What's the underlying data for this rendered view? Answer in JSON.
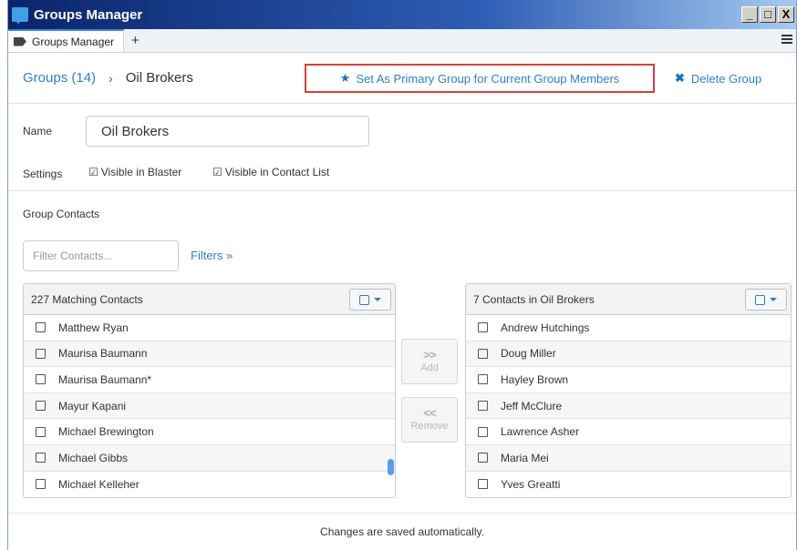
{
  "window": {
    "title": "Groups Manager",
    "controls": {
      "minimize": "_",
      "maximize": "□",
      "close": "X"
    }
  },
  "tabs": {
    "active_label": "Groups Manager",
    "add_label": "+"
  },
  "header": {
    "groups_link": "Groups (14)",
    "separator": "›",
    "current_group": "Oil Brokers",
    "primary_action": "Set As Primary Group for Current Group Members",
    "delete_action": "Delete Group"
  },
  "details": {
    "name_label": "Name",
    "name_value": "Oil Brokers",
    "settings_label": "Settings",
    "settings": [
      {
        "label": "Visible in Blaster",
        "checked": true
      },
      {
        "label": "Visible in Contact List",
        "checked": true
      }
    ]
  },
  "contacts": {
    "section_title": "Group Contacts",
    "filter_placeholder": "Filter Contacts...",
    "filters_link": "Filters »",
    "left_panel": {
      "header": "227 Matching Contacts",
      "items": [
        "Matthew Ryan",
        "Maurisa Baumann",
        "Maurisa Baumann*",
        "Mayur Kapani",
        "Michael Brewington",
        "Michael Gibbs",
        "Michael Kelleher"
      ]
    },
    "add_button": {
      "arrows": ">>",
      "label": "Add"
    },
    "remove_button": {
      "arrows": "<<",
      "label": "Remove"
    },
    "right_panel": {
      "header": "7 Contacts in Oil Brokers",
      "items": [
        "Andrew Hutchings",
        "Doug Miller",
        "Hayley Brown",
        "Jeff McClure",
        "Lawrence Asher",
        "Maria Mei",
        "Yves Greatti"
      ]
    }
  },
  "footer": {
    "status": "Changes are saved automatically."
  },
  "colors": {
    "accent": "#2e7fce",
    "highlight_border": "#d9413b",
    "title_bar": "#0a246a"
  }
}
